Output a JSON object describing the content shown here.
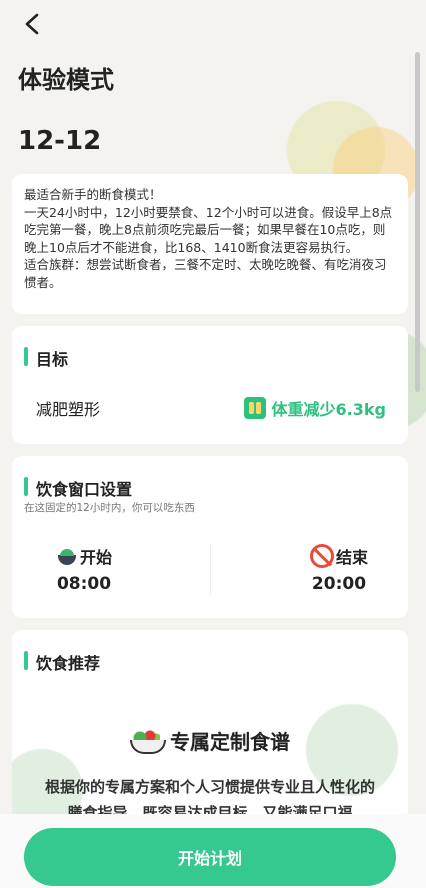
{
  "header": {
    "title": "体验模式",
    "mode": "12-12"
  },
  "description": {
    "line1": "最适合新手的断食模式！",
    "line2": "一天24小时中，12小时要禁食、12个小时可以进食。假设早上8点吃完第一餐，晚上8点前须吃完最后一餐；如果早餐在10点吃，则晚上10点后才不能进食，比168、1410断食法更容易执行。",
    "line3": "适合族群：想尝试断食者，三餐不定时、太晚吃晚餐、有吃消夜习惯者。"
  },
  "goal": {
    "title": "目标",
    "value": "减肥塑形",
    "badge": "体重减少6.3kg"
  },
  "eating_window": {
    "title": "饮食窗口设置",
    "subtitle": "在这固定的12小时内，你可以吃东西",
    "start_label": "开始",
    "start_time": "08:00",
    "end_label": "结束",
    "end_time": "20:00"
  },
  "recommend": {
    "title": "饮食推荐",
    "headline": "专属定制食谱",
    "text": "根据你的专属方案和个人习惯提供专业且人性化的膳食指导，既容易达成目标，又能满足口福"
  },
  "footer": {
    "button": "开始计划"
  },
  "colors": {
    "accent": "#35c88f",
    "background": "#f4f3ef"
  },
  "icons": [
    "back-arrow-icon",
    "scale-icon",
    "bowl-icon",
    "no-food-icon",
    "salad-icon"
  ]
}
